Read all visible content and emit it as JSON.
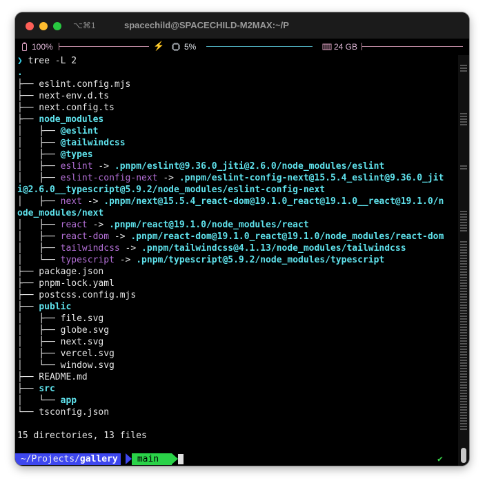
{
  "window": {
    "shortcut": "⌥⌘1",
    "title": "spacechild@SPACECHILD-M2MAX:~/P"
  },
  "status": {
    "battery": "100%",
    "cpu": "5%",
    "memory": "24 GB",
    "battery_level": 1.0,
    "cpu_level": 0.05
  },
  "command": {
    "prompt_symbol": "❯",
    "text": "tree -L 2"
  },
  "tree": {
    "l1": ".",
    "l2": "├── eslint.config.mjs",
    "l3": "├── next-env.d.ts",
    "l4": "├── next.config.ts",
    "l5_prefix": "├── ",
    "l5_dir": "node_modules",
    "l6_prefix": "│   ├── ",
    "l6_dir": "@eslint",
    "l7_prefix": "│   ├── ",
    "l7_dir": "@tailwindcss",
    "l8_prefix": "│   ├── ",
    "l8_dir": "@types",
    "l9_prefix": "│   ├── ",
    "l9_link": "eslint",
    "l9_target": ".pnpm/eslint@9.36.0_jiti@2.6.0/node_modules/eslint",
    "l10_prefix": "│   ├── ",
    "l10_link": "eslint-config-next",
    "l10_target": ".pnpm/eslint-config-next@15.5.4_eslint@9.36.0_jit",
    "l11_wrap": "i@2.6.0__typescript@5.9.2/node_modules/eslint-config-next",
    "l12_prefix": "│   ├── ",
    "l12_link": "next",
    "l12_target": ".pnpm/next@15.5.4_react-dom@19.1.0_react@19.1.0__react@19.1.0/n",
    "l13_wrap": "ode_modules/next",
    "l14_prefix": "│   ├── ",
    "l14_link": "react",
    "l14_target": ".pnpm/react@19.1.0/node_modules/react",
    "l15_prefix": "│   ├── ",
    "l15_link": "react-dom",
    "l15_target": ".pnpm/react-dom@19.1.0_react@19.1.0/node_modules/react-dom",
    "l16_prefix": "│   ├── ",
    "l16_link": "tailwindcss",
    "l16_target": ".pnpm/tailwindcss@4.1.13/node_modules/tailwindcss",
    "l17_prefix": "│   └── ",
    "l17_link": "typescript",
    "l17_target": ".pnpm/typescript@5.9.2/node_modules/typescript",
    "arrow": " -> ",
    "l18": "├── package.json",
    "l19": "├── pnpm-lock.yaml",
    "l20": "├── postcss.config.mjs",
    "l21_prefix": "├── ",
    "l21_dir": "public",
    "l22": "│   ├── file.svg",
    "l23": "│   ├── globe.svg",
    "l24": "│   ├── next.svg",
    "l25": "│   ├── vercel.svg",
    "l26": "│   └── window.svg",
    "l27": "├── README.md",
    "l28_prefix": "├── ",
    "l28_dir": "src",
    "l29_prefix": "│   └── ",
    "l29_dir": "app",
    "l30": "└── tsconfig.json"
  },
  "summary": "15 directories, 13 files",
  "prompt": {
    "path_prefix": " ~/Projects/",
    "path_current": "gallery",
    "branch": " main ",
    "status_icon": "✔"
  }
}
